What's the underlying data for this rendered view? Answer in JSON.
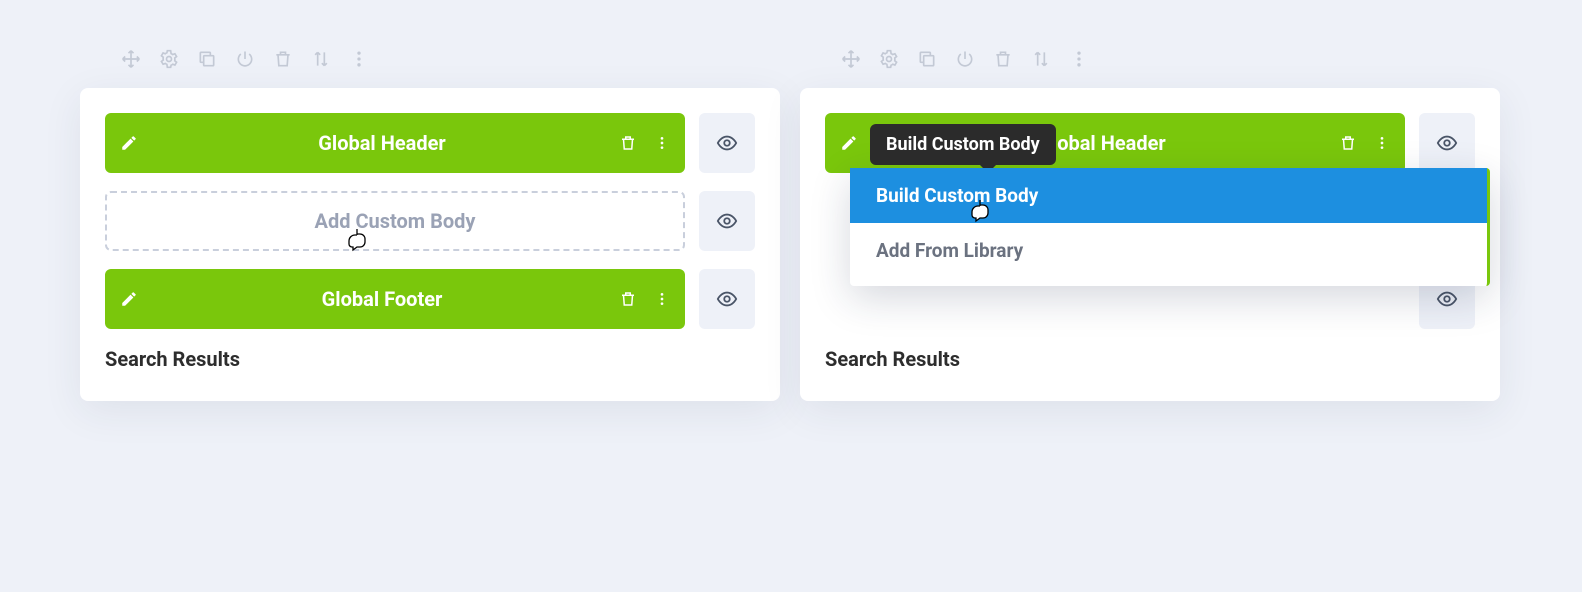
{
  "panels": [
    {
      "header_label": "Global Header",
      "placeholder_label": "Add Custom Body",
      "footer_label": "Global Footer",
      "section_title": "Search Results"
    },
    {
      "header_label": "Global Header",
      "tooltip": "Build Custom Body",
      "option_build": "Build Custom Body",
      "option_library": "Add From Library",
      "section_title": "Search Results"
    }
  ],
  "colors": {
    "green": "#7ac70c",
    "blue": "#1d8fe0",
    "page_bg": "#eef1f8"
  }
}
